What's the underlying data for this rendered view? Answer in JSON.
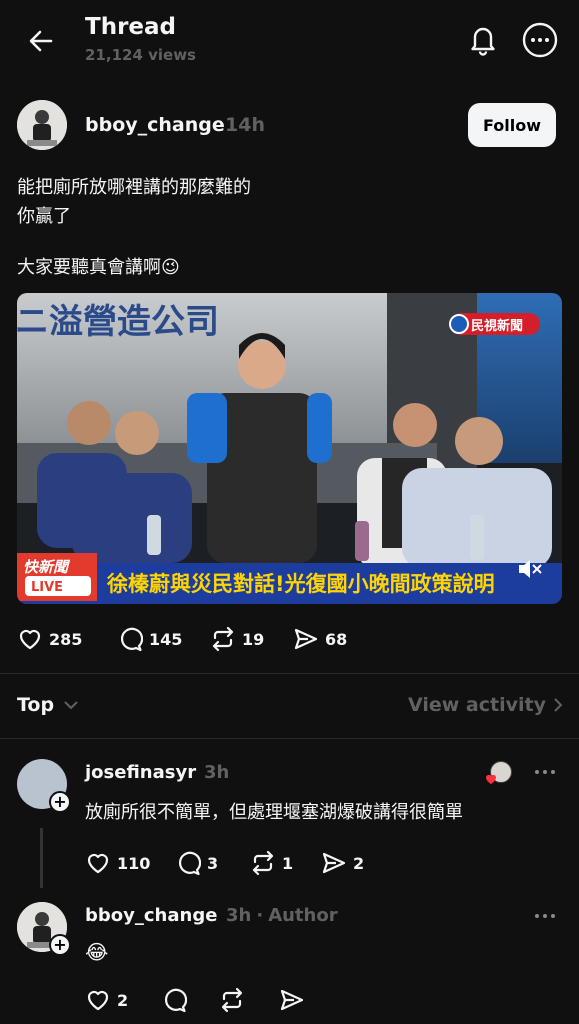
{
  "header": {
    "title": "Thread",
    "views": "21,124 views"
  },
  "post": {
    "username": "bboy_change",
    "time": "14h",
    "follow_label": "Follow",
    "lines": [
      "能把廁所放哪裡講的那麼難的",
      "你贏了",
      "大家要聽真會講啊"
    ],
    "emoji": "😉",
    "image": {
      "banner_text": "徐榛蔚與災民對話!光復國小晚間政策說明",
      "channel_logo": "民視新聞",
      "live_tag_top": "快新聞",
      "live_tag_bottom": "LIVE",
      "truck_text": "ニ溢營造公司"
    },
    "stats": {
      "likes": "285",
      "comments": "145",
      "reposts": "19",
      "shares": "68"
    }
  },
  "sort": {
    "label": "Top",
    "view_activity": "View activity"
  },
  "replies": [
    {
      "username": "josefinasyr",
      "time": "3h",
      "text": "放廁所很不簡單，但處理堰塞湖爆破講得很簡單",
      "stats": {
        "likes": "110",
        "comments": "3",
        "reposts": "1",
        "shares": "2"
      }
    },
    {
      "username": "bboy_change",
      "time": "3h",
      "author_tag": "Author",
      "separator": "·",
      "text": "😂",
      "stats": {
        "likes": "2"
      }
    }
  ],
  "colors": {
    "background": "#101010",
    "text": "#f3f5f7",
    "muted": "#616161",
    "banner_blue": "#1d3d9e",
    "banner_yellow": "#ffd400"
  }
}
